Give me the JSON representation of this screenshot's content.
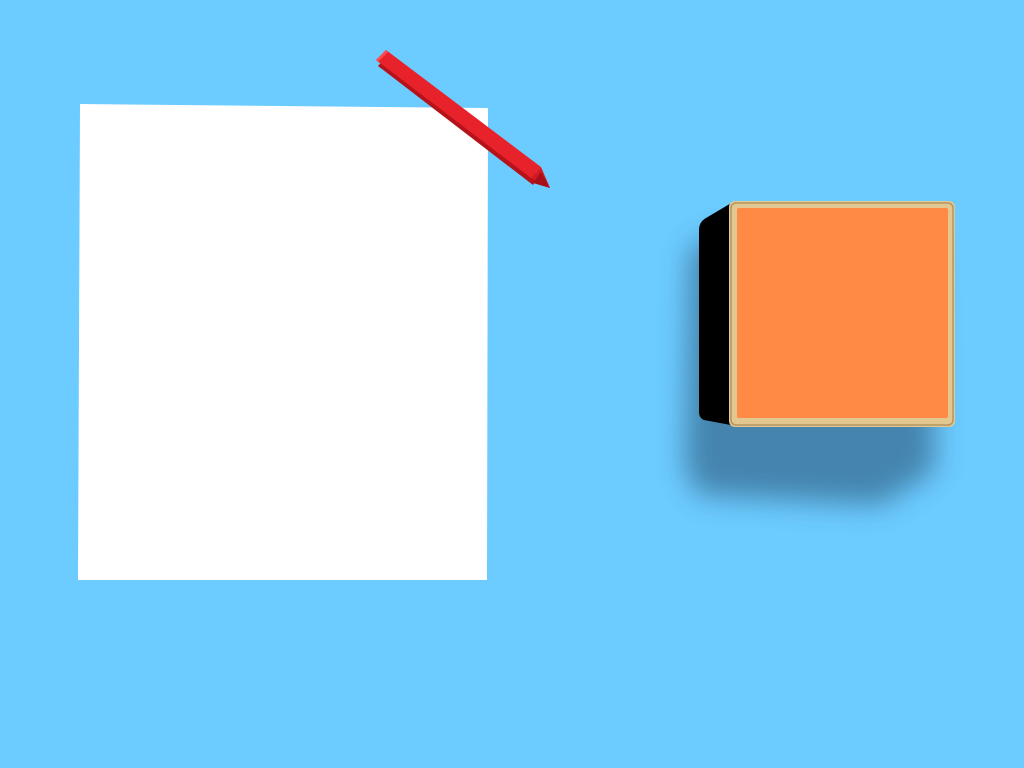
{
  "scene": {
    "colors": {
      "background": "#6ccbff",
      "paper": "#ffffff",
      "pencil_body": "#e8222a",
      "pencil_side": "#b5121a",
      "pencil_top": "#ff4a4f",
      "block_face": "#ff8a45",
      "block_rim": "#e2c890",
      "block_side": "#000000",
      "block_shadow": "#3f7da5"
    },
    "objects": {
      "paper": "blank-paper-sheet",
      "pencil": "red-crayon",
      "block": "orange-block"
    }
  }
}
